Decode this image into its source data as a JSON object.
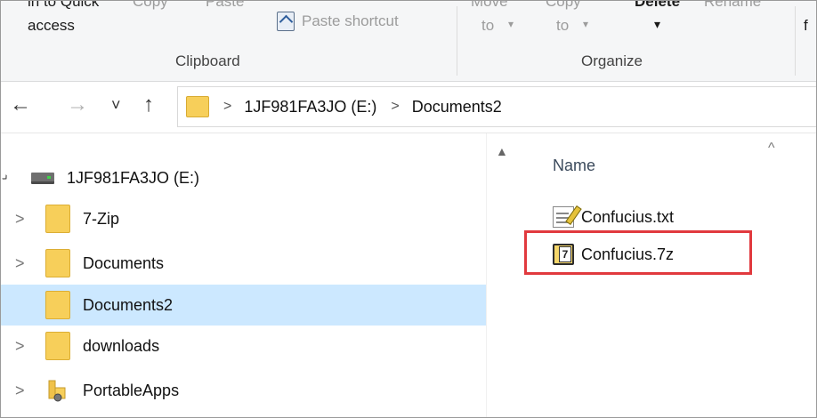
{
  "ribbon": {
    "pin_label_line1": "in to Quick",
    "pin_label_line2": "access",
    "copy_label": "Copy",
    "paste_label": "Paste",
    "paste_shortcut_label": "Paste shortcut",
    "move_to_line1": "Move",
    "move_to_line2": "to",
    "copy_to_line1": "Copy",
    "copy_to_line2": "to",
    "delete_label": "Delete",
    "rename_label": "Rename",
    "dropdown_glyph": "▾",
    "cut_edge_letter": "f",
    "clipboard_group": "Clipboard",
    "organize_group": "Organize"
  },
  "address": {
    "back_glyph": "←",
    "forward_glyph": "→",
    "recent_glyph": "˅",
    "up_glyph": "↑",
    "separator": ">",
    "crumbs": [
      "1JF981FA3JO (E:)",
      "Documents2"
    ]
  },
  "tree": {
    "drive": "1JF981FA3JO (E:)",
    "items": [
      {
        "label": "7-Zip",
        "chevron": ">"
      },
      {
        "label": "Documents",
        "chevron": ">"
      },
      {
        "label": "Documents2",
        "chevron": ""
      },
      {
        "label": "downloads",
        "chevron": ">"
      },
      {
        "label": "PortableApps",
        "chevron": ">"
      }
    ]
  },
  "content": {
    "column_name": "Name",
    "sort_glyph": "^",
    "files": [
      {
        "name": "Confucius.txt",
        "icon": "text-file-icon"
      },
      {
        "name": "Confucius.7z",
        "icon": "7z-archive-icon"
      }
    ]
  },
  "colors": {
    "selection": "#cce8ff",
    "highlight_box": "#e1393e",
    "folder": "#f7cf5a"
  }
}
